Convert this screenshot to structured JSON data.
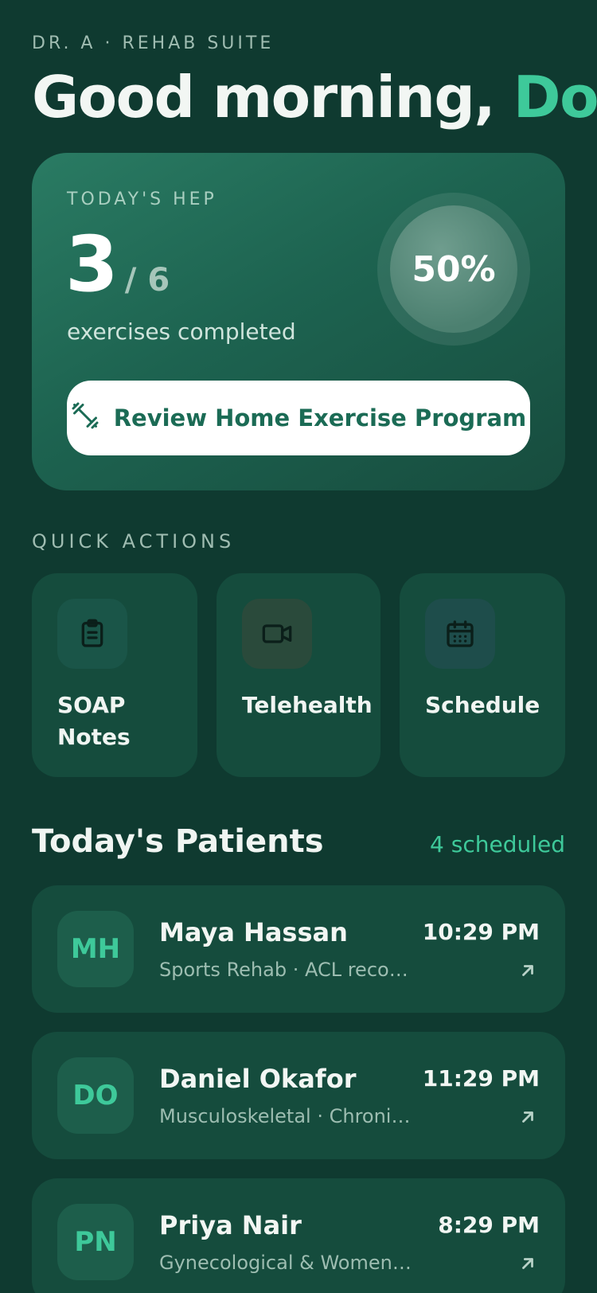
{
  "header": {
    "eyebrow": "DR. A · REHAB SUITE",
    "greeting": "Good morning,",
    "greeting_accent": "Doctor"
  },
  "hep": {
    "label": "TODAY'S HEP",
    "completed": "3",
    "total": "/ 6",
    "subtitle": "exercises completed",
    "percent_text": "50%",
    "progress_fraction": 0.5,
    "button_label": "Review Home Exercise Program",
    "button_icon": "dumbbell-icon"
  },
  "quick_actions": {
    "label": "QUICK ACTIONS",
    "items": [
      {
        "label": "SOAP Notes",
        "icon": "clipboard-icon"
      },
      {
        "label": "Telehealth",
        "icon": "video-camera-icon"
      },
      {
        "label": "Schedule",
        "icon": "calendar-icon"
      }
    ]
  },
  "patients": {
    "title": "Today's Patients",
    "count_text": "4 scheduled",
    "items": [
      {
        "initials": "MH",
        "name": "Maya Hassan",
        "detail": "Sports Rehab · ACL reconstruction",
        "time": "10:29 PM"
      },
      {
        "initials": "DO",
        "name": "Daniel Okafor",
        "detail": "Musculoskeletal · Chronic low back pain",
        "time": "11:29 PM"
      },
      {
        "initials": "PN",
        "name": "Priya Nair",
        "detail": "Gynecological & Women's Health",
        "time": "8:29 PM"
      }
    ]
  },
  "colors": {
    "background": "#0f3a30",
    "card": "#154c3d",
    "accent": "#3ec99a",
    "button_text": "#1b6b55"
  }
}
